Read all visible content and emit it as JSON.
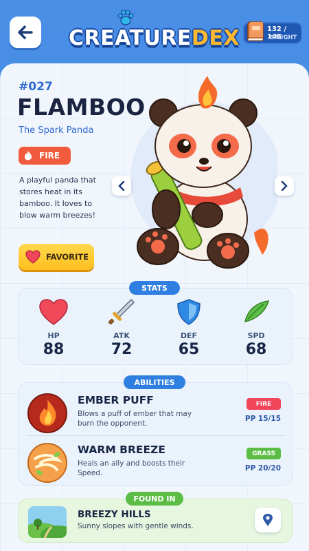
{
  "header": {
    "logo_left": "CREATURE",
    "logo_right": "DEX",
    "caught_count": "132 / 148",
    "caught_label": "CAUGHT"
  },
  "creature": {
    "number": "#027",
    "name": "FLAMBOO",
    "subtitle": "The Spark Panda",
    "type": "FIRE",
    "description": "A playful panda that stores heat in its bamboo. It loves to blow warm breezes!",
    "favorite_label": "FAVORITE"
  },
  "stats": {
    "header": "STATS",
    "items": [
      {
        "label": "HP",
        "value": "88",
        "icon": "heart-icon",
        "color": "#f04a5a"
      },
      {
        "label": "ATK",
        "value": "72",
        "icon": "sword-icon",
        "color": "#9aa7b8"
      },
      {
        "label": "DEF",
        "value": "65",
        "icon": "shield-icon",
        "color": "#2f8ae6"
      },
      {
        "label": "SPD",
        "value": "68",
        "icon": "leaf-wing-icon",
        "color": "#5cc04a"
      }
    ]
  },
  "abilities": {
    "header": "ABILITIES",
    "items": [
      {
        "name": "EMBER PUFF",
        "description": "Blows a puff of ember that may burn the opponent.",
        "type": "FIRE",
        "type_color": "#f0455b",
        "pp": "PP 15/15"
      },
      {
        "name": "WARM BREEZE",
        "description": "Heals an ally and boosts their Speed.",
        "type": "GRASS",
        "type_color": "#5bbd45",
        "pp": "PP 20/20"
      }
    ]
  },
  "found_in": {
    "header": "FOUND IN",
    "location": "BREEZY HILLS",
    "description": "Sunny slopes with gentle winds."
  }
}
